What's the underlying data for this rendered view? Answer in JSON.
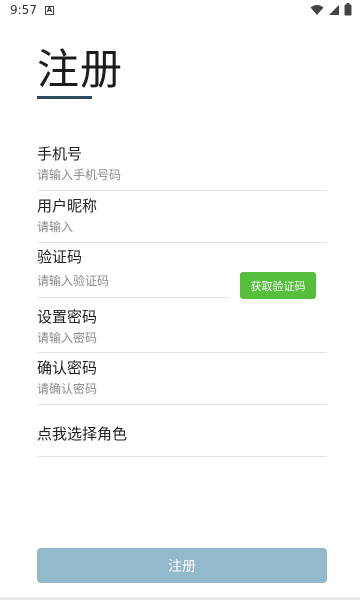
{
  "status_bar": {
    "time": "9:57",
    "notification_icon": "a-icon",
    "icons": [
      "wifi-icon",
      "signal-icon",
      "battery-icon"
    ]
  },
  "page": {
    "title": "注册",
    "accent_color": "#2f4a5c"
  },
  "form": {
    "phone": {
      "label": "手机号",
      "placeholder": "请输入手机号码",
      "value": ""
    },
    "nickname": {
      "label": "用户昵称",
      "placeholder": "请输入",
      "value": ""
    },
    "code": {
      "label": "验证码",
      "placeholder": "请输入验证码",
      "value": "",
      "get_code_label": "获取验证码",
      "button_color": "#55be3a"
    },
    "password": {
      "label": "设置密码",
      "placeholder": "请输入密码",
      "value": ""
    },
    "confirm_password": {
      "label": "确认密码",
      "placeholder": "请确认密码",
      "value": ""
    },
    "role": {
      "label": "点我选择角色"
    }
  },
  "submit": {
    "label": "注册",
    "color": "#92b8cb"
  }
}
